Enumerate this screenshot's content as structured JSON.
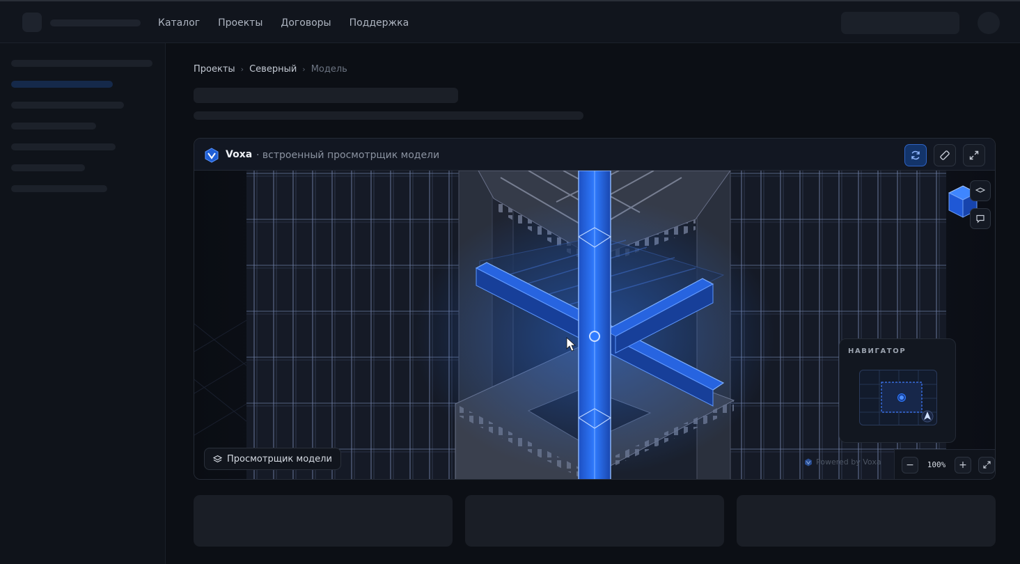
{
  "nav": {
    "items": [
      "Каталог",
      "Проекты",
      "Договоры",
      "Поддержка"
    ]
  },
  "breadcrumb": {
    "items": [
      "Проекты",
      "Северный",
      "Модель"
    ],
    "separator": "›"
  },
  "viewer": {
    "brand": "Voxa",
    "description": "· встроенный просмотрщик модели",
    "chip_label": "Просмотрщик модели",
    "powered_by": "Powered by Voxa",
    "navigator_title": "НАВИГАТОР",
    "zoom": "100%",
    "zoom_out_label": "−",
    "zoom_in_label": "+",
    "accent": "#2f7bff"
  }
}
